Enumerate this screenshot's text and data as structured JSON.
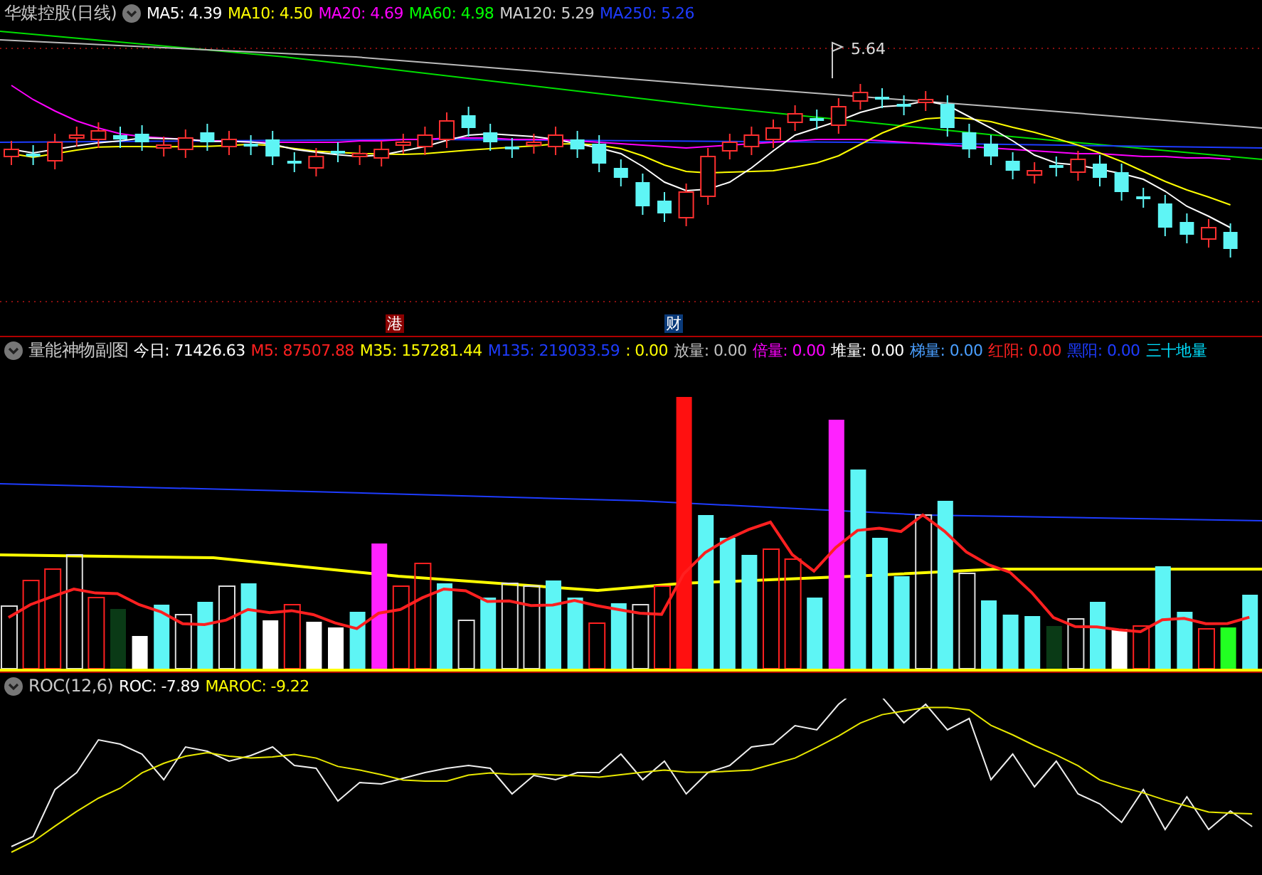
{
  "main_panel": {
    "title": "华媒控股(日线)",
    "indicators": [
      {
        "text": "MA5: 4.39",
        "color": "#ffffff"
      },
      {
        "text": "MA10: 4.50",
        "color": "#ffff00"
      },
      {
        "text": "MA20: 4.69",
        "color": "#ff00ff"
      },
      {
        "text": "MA60: 4.98",
        "color": "#00ff00"
      },
      {
        "text": "MA120: 5.29",
        "color": "#d0d0d0"
      },
      {
        "text": "MA250: 5.26",
        "color": "#1e3cff"
      }
    ],
    "high_label": "5.64",
    "event_markers": [
      {
        "text": "港",
        "color": "#8b0000"
      },
      {
        "text": "财",
        "color": "#0a3a7a"
      }
    ]
  },
  "volume_panel": {
    "title": "量能神物副图",
    "indicators": [
      {
        "text": "今日: 71426.63",
        "color": "#ffffff"
      },
      {
        "text": "M5: 87507.88",
        "color": "#ff2020"
      },
      {
        "text": "M35: 157281.44",
        "color": "#ffff00"
      },
      {
        "text": "M135: 219033.59",
        "color": "#1e3cff"
      },
      {
        "text": ": 0.00",
        "color": "#ffff00"
      },
      {
        "text": "放量: 0.00",
        "color": "#c0c0c0"
      },
      {
        "text": "倍量: 0.00",
        "color": "#ff00ff"
      },
      {
        "text": "堆量: 0.00",
        "color": "#ffffff"
      },
      {
        "text": "梯量: 0.00",
        "color": "#4a9fff"
      },
      {
        "text": "红阳: 0.00",
        "color": "#ff2020"
      },
      {
        "text": "黑阳: 0.00",
        "color": "#1e3cff"
      },
      {
        "text": "三十地量",
        "color": "#00e0ff"
      }
    ]
  },
  "roc_panel": {
    "title": "ROC(12,6)",
    "indicators": [
      {
        "text": "ROC: -7.89",
        "color": "#ffffff"
      },
      {
        "text": "MAROC: -9.22",
        "color": "#ffff00"
      }
    ]
  }
}
